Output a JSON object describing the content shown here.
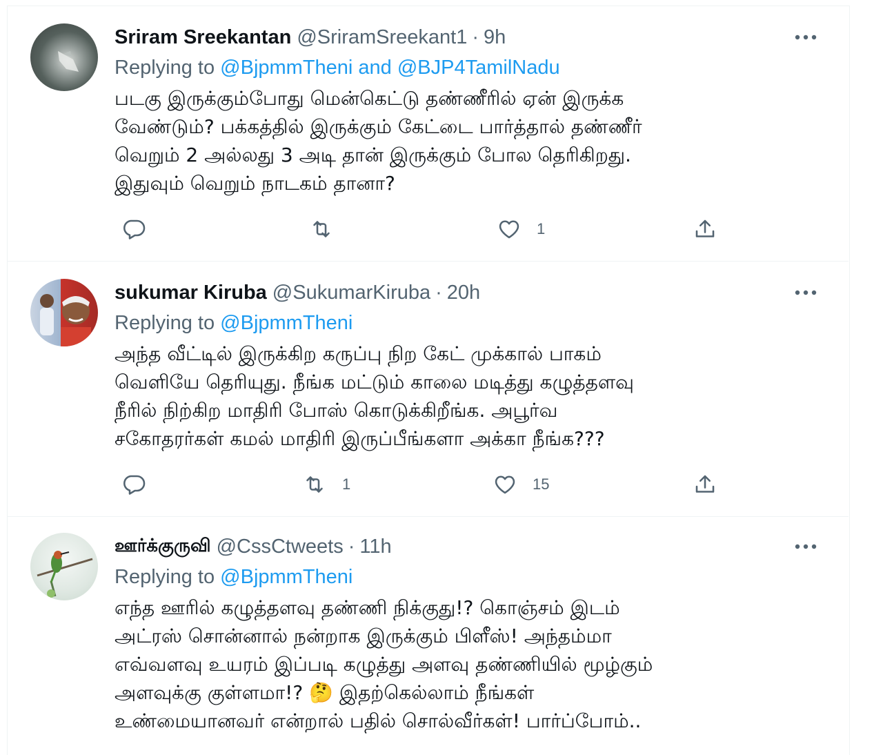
{
  "tweets": [
    {
      "name": "Sriram Sreekantan",
      "handle": "@SriramSreekant1",
      "separator": "·",
      "time": "9h",
      "replying_prefix": "Replying to",
      "replying_to": "@BjpmmTheni and @BJP4TamilNadu",
      "text": "படகு இருக்கும்போது மென்கெட்டு தண்ணீரில் ஏன் இருக்க\nவேண்டும்? பக்கத்தில் இருக்கும் கேட்டை பார்த்தால் தண்ணீர்\nவெறும் 2 அல்லது 3 அடி தான் இருக்கும் போல தெரிகிறது.\nஇதுவும் வெறும் நாடகம் தானா?",
      "retweet_count": "",
      "like_count": "1"
    },
    {
      "name": "sukumar Kiruba",
      "handle": "@SukumarKiruba",
      "separator": "·",
      "time": "20h",
      "replying_prefix": "Replying to",
      "replying_to": "@BjpmmTheni",
      "text": "அந்த வீட்டில் இருக்கிற கருப்பு நிற கேட் முக்கால் பாகம்\nவெளியே தெரியுது. நீங்க மட்டும் காலை மடித்து கழுத்தளவு\nநீரில் நிற்கிற மாதிரி போஸ் கொடுக்கிறீங்க. அபூர்வ\nசகோதரர்கள் கமல் மாதிரி இருப்பீங்களா அக்கா நீங்க???",
      "retweet_count": "1",
      "like_count": "15"
    },
    {
      "name": "ஊர்க்குருவி",
      "handle": "@CssCtweets",
      "separator": "·",
      "time": "11h",
      "replying_prefix": "Replying to",
      "replying_to": "@BjpmmTheni",
      "text": "எந்த ஊரில் கழுத்தளவு தண்ணி நிக்குது!? கொஞ்சம் இடம்\nஅட்ரஸ் சொன்னால் நன்றாக இருக்கும் பிளீஸ்! அந்தம்மா\nஎவ்வளவு உயரம் இப்படி கழுத்து அளவு தண்ணியில் மூழ்கும்\nஅளவுக்கு குள்ளமா!? 🤔 இதற்கெல்லாம் நீங்கள்\nஉண்மையானவர் என்றால் பதில் சொல்வீர்கள்! பார்ப்போம்..",
      "retweet_count": "",
      "like_count": ""
    }
  ],
  "icons": {
    "reply": "reply-icon",
    "retweet": "retweet-icon",
    "like": "heart-icon",
    "share": "share-icon",
    "more": "more-icon"
  },
  "colors": {
    "link": "#1d9bf0",
    "secondary_text": "#536471",
    "primary_text": "#0f1419",
    "divider": "#eff3f4"
  }
}
